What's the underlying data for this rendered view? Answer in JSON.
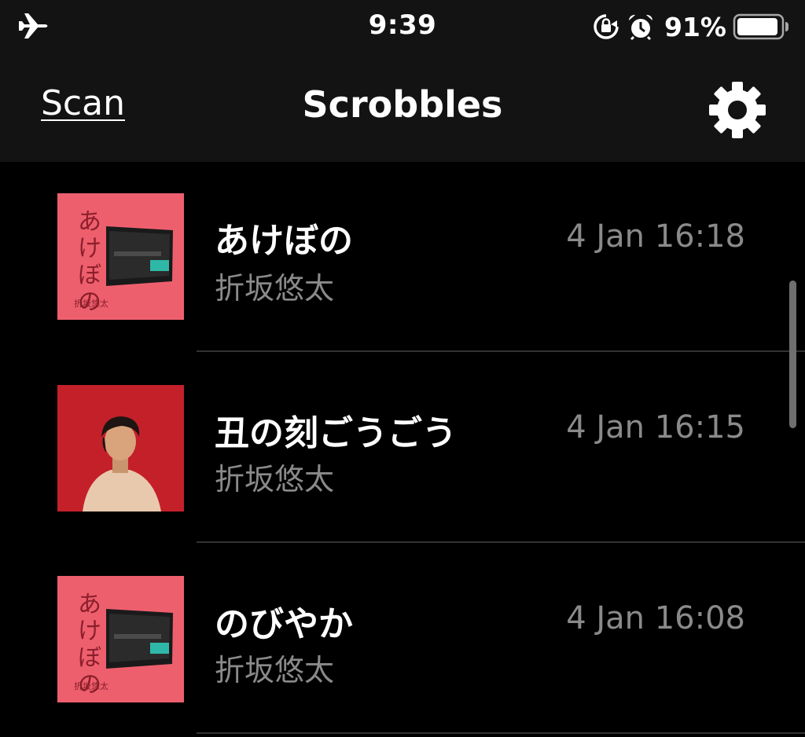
{
  "status_bar": {
    "time": "9:39",
    "battery_percent": "91%",
    "battery_level": 0.91,
    "icons": [
      "airplane-icon",
      "lock-rotation-icon",
      "alarm-icon",
      "battery-icon"
    ]
  },
  "nav": {
    "scan_label": "Scan",
    "title": "Scrobbles",
    "settings_icon": "gear-icon"
  },
  "scrobbles": [
    {
      "title": "あけぼの",
      "artist": "折坂悠太",
      "time": "4 Jan 16:18",
      "cover_text": "あけぼの",
      "cover_small_text": "折坂悠太",
      "cover_color": "#ee5f6e"
    },
    {
      "title": "丑の刻ごうごう",
      "artist": "折坂悠太",
      "time": "4 Jan 16:15",
      "cover_color": "#c4202a"
    },
    {
      "title": "のびやか",
      "artist": "折坂悠太",
      "time": "4 Jan 16:08",
      "cover_text": "あけぼの",
      "cover_small_text": "折坂悠太",
      "cover_color": "#ee5f6e"
    }
  ],
  "colors": {
    "bar_background": "#131313",
    "list_background": "#000000",
    "secondary_text": "#8a8a8a",
    "separator": "#333333"
  }
}
